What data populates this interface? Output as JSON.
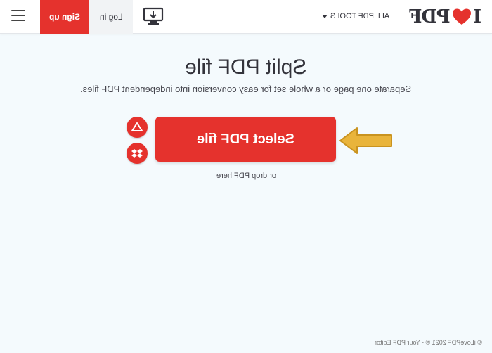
{
  "header": {
    "signup_label": "Sign up",
    "login_label": "Log in",
    "tools_label": "ALL PDF TOOLS",
    "logo_text": "PDF",
    "logo_prefix": "I"
  },
  "main": {
    "title": "Split PDF file",
    "subtitle": "Separate one page or a whole set for easy conversion into independent PDF files.",
    "select_label": "Select PDF file",
    "drop_hint": "or drop PDF here"
  },
  "footer": {
    "copyright": "© iLovePDF 2021 ® - Your PDF Editor"
  },
  "icons": [
    "hamburger-menu-icon",
    "desktop-download-icon",
    "heart-icon",
    "google-drive-icon",
    "dropbox-icon",
    "arrow-pointer-icon"
  ],
  "colors": {
    "brand_red": "#e5322d",
    "page_background": "#f4fafd",
    "arrow_yellow": "#e9b43b",
    "text_dark": "#33333b"
  }
}
